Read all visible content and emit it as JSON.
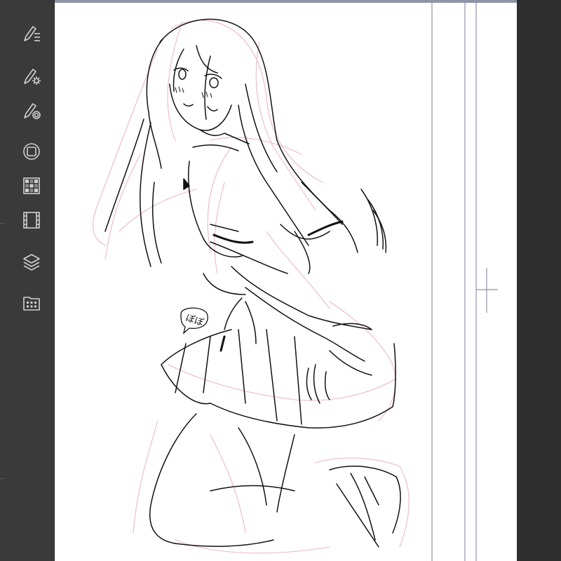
{
  "sidebar": {
    "tools": [
      {
        "name": "sub-tool-list-icon"
      },
      {
        "name": "tool-property-icon"
      },
      {
        "name": "brush-size-icon"
      },
      {
        "name": "color-circle-icon"
      },
      {
        "name": "color-set-icon"
      },
      {
        "name": "animation-timeline-icon"
      },
      {
        "name": "layers-icon"
      },
      {
        "name": "material-palette-icon"
      }
    ]
  },
  "canvas": {
    "colors": {
      "paper": "#ffffff",
      "ink": "#111111",
      "sketch": "#e8b4c0",
      "guide": "#8e93a6"
    }
  },
  "signature": {
    "text": "ぽぽ"
  }
}
